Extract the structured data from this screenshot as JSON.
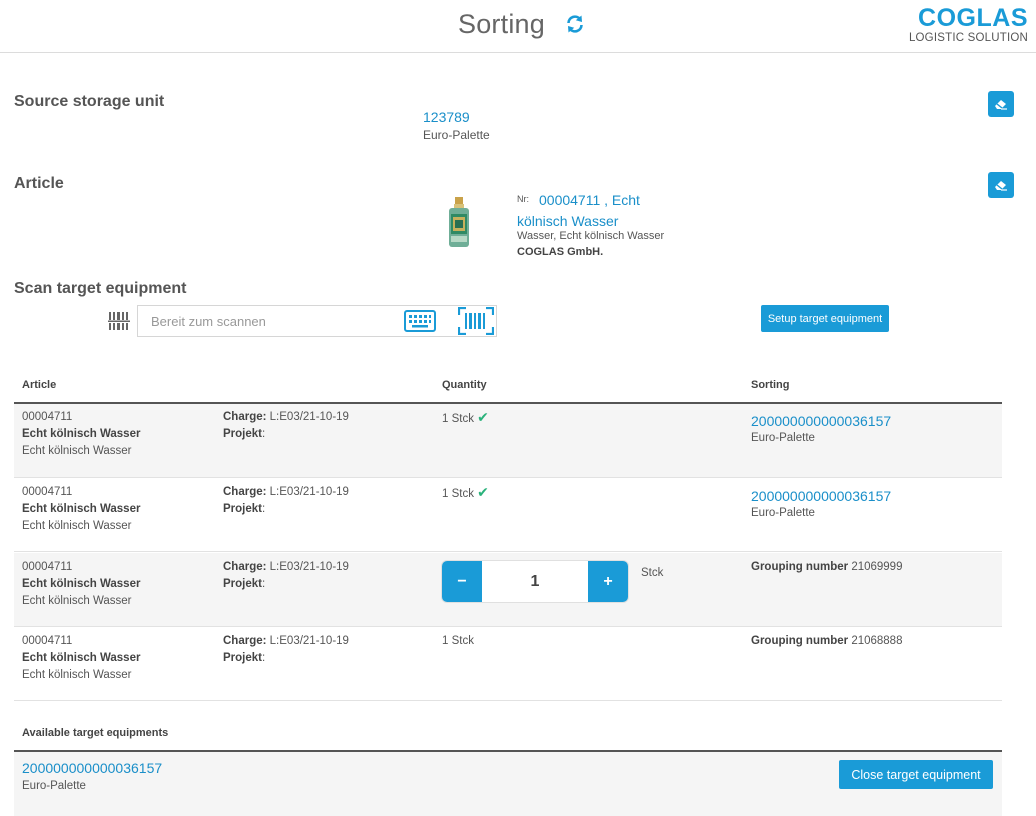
{
  "header": {
    "title": "Sorting",
    "refresh_icon": "refresh-icon",
    "logo_word": "COGLAS",
    "logo_sub": "LOGISTIC SOLUTION"
  },
  "colors": {
    "accent": "#1a9bd7",
    "check": "#2ab27b"
  },
  "source": {
    "label": "Source storage unit",
    "id": "123789",
    "type": "Euro-Palette",
    "clear_icon": "eraser-icon"
  },
  "article": {
    "label": "Article",
    "nr_label": "Nr:",
    "nr": "00004711",
    "name": "Echt kölnisch Wasser",
    "description": "Wasser, Echt kölnisch Wasser",
    "company": "COGLAS GmbH.",
    "clear_icon": "eraser-icon"
  },
  "scan": {
    "label": "Scan target equipment",
    "placeholder": "Bereit zum scannen",
    "setup_button": "Setup target equipment"
  },
  "table": {
    "headers": {
      "article": "Article",
      "quantity": "Quantity",
      "sorting": "Sorting"
    },
    "charge_label": "Charge:",
    "projekt_label": "Projekt",
    "rows": [
      {
        "nr": "00004711",
        "name": "Echt kölnisch Wasser",
        "desc": "Echt kölnisch Wasser",
        "charge": "L:E03/21-10-19",
        "projekt": ":",
        "qty": "1 Stck",
        "checked": true,
        "sorting_id": "200000000000036157",
        "sorting_type": "Euro-Palette"
      },
      {
        "nr": "00004711",
        "name": "Echt kölnisch Wasser",
        "desc": "Echt kölnisch Wasser",
        "charge": "L:E03/21-10-19",
        "projekt": ":",
        "qty": "1 Stck",
        "checked": true,
        "sorting_id": "200000000000036157",
        "sorting_type": "Euro-Palette"
      },
      {
        "nr": "00004711",
        "name": "Echt kölnisch Wasser",
        "desc": "Echt kölnisch Wasser",
        "charge": "L:E03/21-10-19",
        "projekt": ":",
        "stepper_value": "1",
        "minus": "−",
        "plus": "+",
        "unit": "Stck",
        "grouping_label": "Grouping number",
        "grouping_number": "21069999"
      },
      {
        "nr": "00004711",
        "name": "Echt kölnisch Wasser",
        "desc": "Echt kölnisch Wasser",
        "charge": "L:E03/21-10-19",
        "projekt": ":",
        "qty": "1 Stck",
        "grouping_label": "Grouping number",
        "grouping_number": "21068888"
      }
    ]
  },
  "available": {
    "label": "Available target equipments",
    "id": "200000000000036157",
    "type": "Euro-Palette",
    "close_button": "Close target equipment"
  }
}
